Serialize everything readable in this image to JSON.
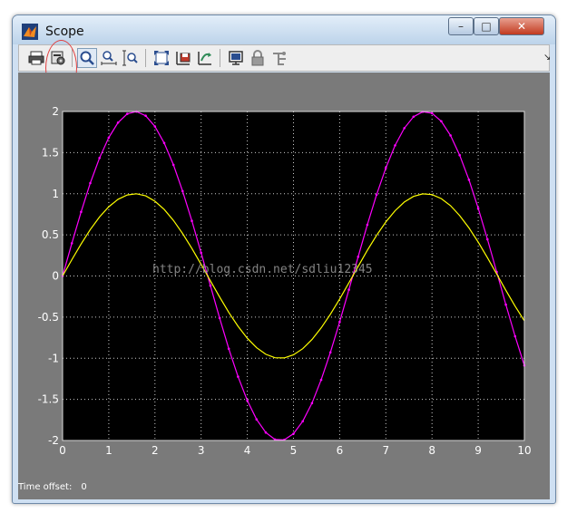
{
  "window": {
    "title": "Scope"
  },
  "titlebar": {
    "minimize": "–",
    "maximize": "□",
    "close": "✕"
  },
  "toolbar": {
    "items": [
      {
        "name": "print-icon"
      },
      {
        "name": "parameters-icon"
      },
      {
        "name": "zoom-icon"
      },
      {
        "name": "zoom-x-icon"
      },
      {
        "name": "zoom-y-icon"
      },
      {
        "name": "autoscale-icon"
      },
      {
        "name": "save-axes-icon"
      },
      {
        "name": "restore-axes-icon"
      },
      {
        "name": "floating-scope-icon"
      },
      {
        "name": "lock-icon"
      },
      {
        "name": "signal-selection-icon"
      }
    ],
    "more_glyph": "↘"
  },
  "status": {
    "time_offset_label": "Time offset:",
    "time_offset_value": "0"
  },
  "watermark": "http://blog.csdn.net/sdliu12345",
  "chart_data": {
    "type": "line",
    "xlim": [
      0,
      10
    ],
    "ylim": [
      -2,
      2
    ],
    "grid": true,
    "x_ticks": [
      "0",
      "1",
      "2",
      "3",
      "4",
      "5",
      "6",
      "7",
      "8",
      "9",
      "10"
    ],
    "y_ticks": [
      "2",
      "1.5",
      "1",
      "0.5",
      "0",
      "-0.5",
      "-1",
      "-1.5",
      "-2"
    ],
    "series": [
      {
        "color": "#ff00ff",
        "amplitude": 2,
        "step": 0.2,
        "x_max": 10
      },
      {
        "color": "#ffff00",
        "amplitude": 1,
        "step": 0.2,
        "x_max": 10
      }
    ],
    "background": "#000000",
    "grid_color": "#ffffff"
  }
}
